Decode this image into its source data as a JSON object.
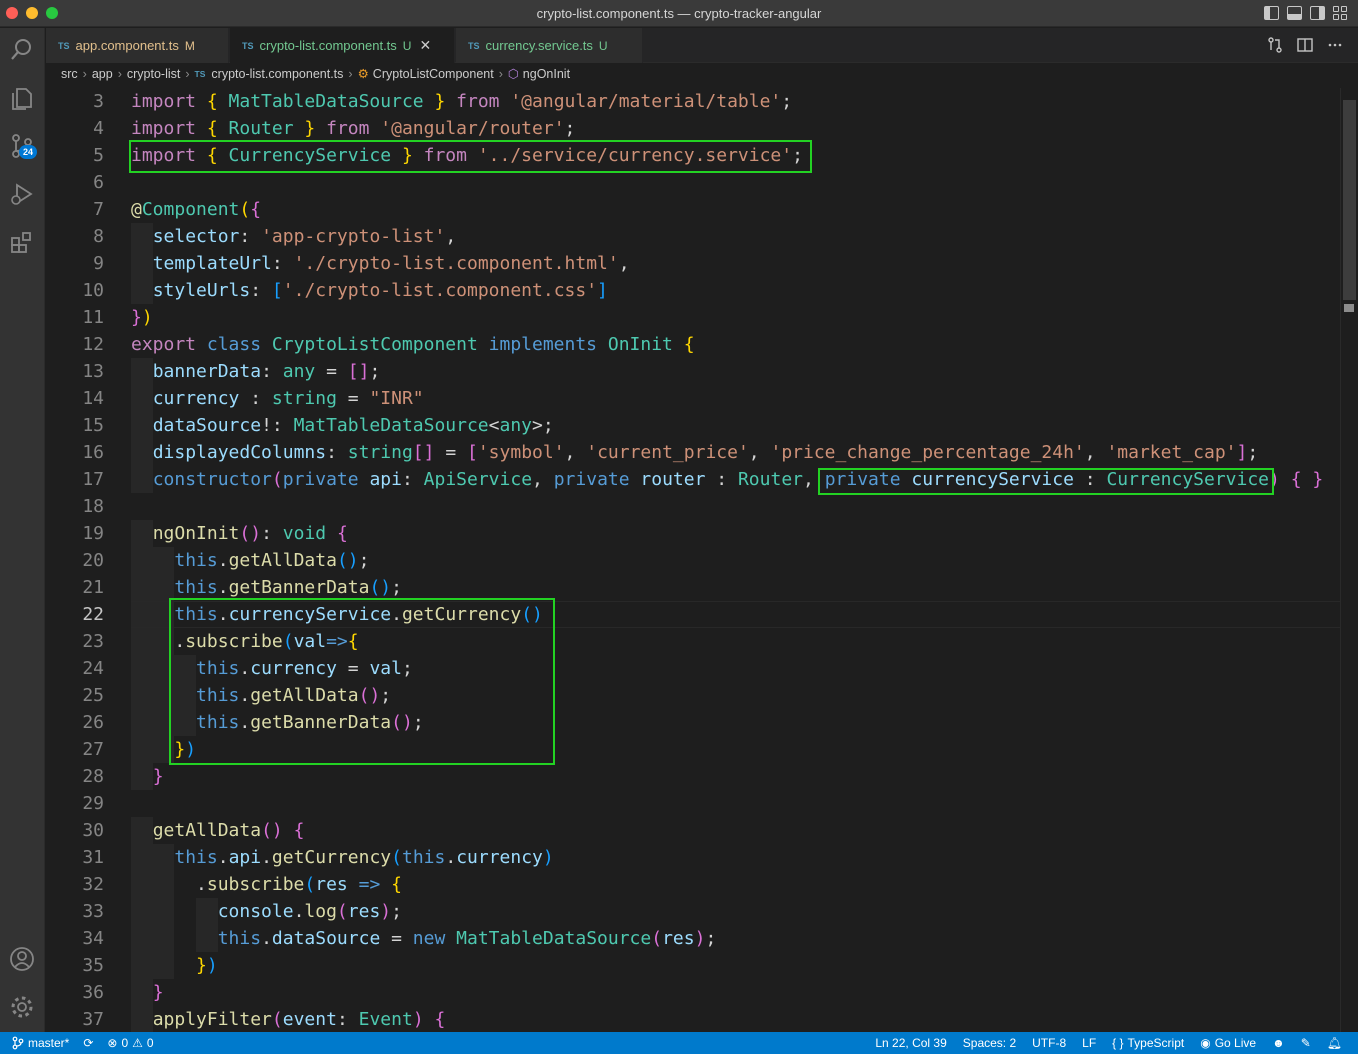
{
  "window": {
    "title": "crypto-list.component.ts — crypto-tracker-angular"
  },
  "activity": {
    "scm_badge": "24"
  },
  "tabs": [
    {
      "icon": "TS",
      "label": "app.component.ts",
      "status": "M",
      "kind": "m"
    },
    {
      "icon": "TS",
      "label": "crypto-list.component.ts",
      "status": "U",
      "kind": "u",
      "active": true
    },
    {
      "icon": "TS",
      "label": "currency.service.ts",
      "status": "U",
      "kind": "u"
    }
  ],
  "breadcrumb": {
    "seg1": "src",
    "seg2": "app",
    "seg3": "crypto-list",
    "file_icon": "TS",
    "file": "crypto-list.component.ts",
    "class_name": "CryptoListComponent",
    "method": "ngOnInit"
  },
  "colors": {
    "highlight_box": "#23d223",
    "statusbar": "#007acc",
    "keyword": "#c586c0",
    "string": "#ce9178",
    "type": "#4ec9b0",
    "function": "#dcdcaa",
    "variable": "#9cdcfe"
  },
  "editor": {
    "current_line": 22,
    "lines": [
      {
        "n": "3",
        "t": [
          [
            "kw",
            "import "
          ],
          [
            "b1",
            "{ "
          ],
          [
            "ty",
            "MatTableDataSource"
          ],
          [
            "b1",
            " }"
          ],
          [
            "kw",
            " from "
          ],
          [
            "str",
            "'@angular/material/table'"
          ],
          [
            "pl",
            ";"
          ]
        ]
      },
      {
        "n": "4",
        "t": [
          [
            "kw",
            "import "
          ],
          [
            "b1",
            "{ "
          ],
          [
            "ty",
            "Router"
          ],
          [
            "b1",
            " }"
          ],
          [
            "kw",
            " from "
          ],
          [
            "str",
            "'@angular/router'"
          ],
          [
            "pl",
            ";"
          ]
        ]
      },
      {
        "n": "5",
        "t": [
          [
            "kw",
            "import "
          ],
          [
            "b1",
            "{ "
          ],
          [
            "ty",
            "CurrencyService"
          ],
          [
            "b1",
            " }"
          ],
          [
            "kw",
            " from "
          ],
          [
            "str",
            "'../service/currency.service'"
          ],
          [
            "pl",
            ";"
          ]
        ]
      },
      {
        "n": "6",
        "t": []
      },
      {
        "n": "7",
        "t": [
          [
            "fn",
            "@"
          ],
          [
            "ty",
            "Component"
          ],
          [
            "b1",
            "("
          ],
          [
            "b2",
            "{"
          ]
        ]
      },
      {
        "n": "8",
        "t": [
          [
            "pl",
            "  "
          ],
          [
            "vr",
            "selector"
          ],
          [
            "pl",
            ": "
          ],
          [
            "str",
            "'app-crypto-list'"
          ],
          [
            "pl",
            ","
          ]
        ]
      },
      {
        "n": "9",
        "t": [
          [
            "pl",
            "  "
          ],
          [
            "vr",
            "templateUrl"
          ],
          [
            "pl",
            ": "
          ],
          [
            "str",
            "'./crypto-list.component.html'"
          ],
          [
            "pl",
            ","
          ]
        ]
      },
      {
        "n": "10",
        "t": [
          [
            "pl",
            "  "
          ],
          [
            "vr",
            "styleUrls"
          ],
          [
            "pl",
            ": "
          ],
          [
            "b3",
            "["
          ],
          [
            "str",
            "'./crypto-list.component.css'"
          ],
          [
            "b3",
            "]"
          ]
        ]
      },
      {
        "n": "11",
        "t": [
          [
            "b2",
            "}"
          ],
          [
            "b1",
            ")"
          ]
        ]
      },
      {
        "n": "12",
        "t": [
          [
            "kw",
            "export "
          ],
          [
            "bl",
            "class "
          ],
          [
            "ty",
            "CryptoListComponent "
          ],
          [
            "bl",
            "implements "
          ],
          [
            "ty",
            "OnInit "
          ],
          [
            "b1",
            "{"
          ]
        ]
      },
      {
        "n": "13",
        "t": [
          [
            "pl",
            "  "
          ],
          [
            "vr",
            "bannerData"
          ],
          [
            "pl",
            ": "
          ],
          [
            "ty",
            "any"
          ],
          [
            "pl",
            " = "
          ],
          [
            "b2",
            "[]"
          ],
          [
            "pl",
            ";"
          ]
        ]
      },
      {
        "n": "14",
        "t": [
          [
            "pl",
            "  "
          ],
          [
            "vr",
            "currency"
          ],
          [
            "pl",
            " : "
          ],
          [
            "ty",
            "string"
          ],
          [
            "pl",
            " = "
          ],
          [
            "str",
            "\"INR\""
          ]
        ]
      },
      {
        "n": "15",
        "t": [
          [
            "pl",
            "  "
          ],
          [
            "vr",
            "dataSource"
          ],
          [
            "pl",
            "!: "
          ],
          [
            "ty",
            "MatTableDataSource"
          ],
          [
            "pl",
            "<"
          ],
          [
            "ty",
            "any"
          ],
          [
            "pl",
            ">;"
          ]
        ]
      },
      {
        "n": "16",
        "t": [
          [
            "pl",
            "  "
          ],
          [
            "vr",
            "displayedColumns"
          ],
          [
            "pl",
            ": "
          ],
          [
            "ty",
            "string"
          ],
          [
            "b2",
            "[]"
          ],
          [
            "pl",
            " = "
          ],
          [
            "b2",
            "["
          ],
          [
            "str",
            "'symbol'"
          ],
          [
            "pl",
            ", "
          ],
          [
            "str",
            "'current_price'"
          ],
          [
            "pl",
            ", "
          ],
          [
            "str",
            "'price_change_percentage_24h'"
          ],
          [
            "pl",
            ", "
          ],
          [
            "str",
            "'market_cap'"
          ],
          [
            "b2",
            "]"
          ],
          [
            "pl",
            ";"
          ]
        ]
      },
      {
        "n": "17",
        "t": [
          [
            "pl",
            "  "
          ],
          [
            "bl",
            "constructor"
          ],
          [
            "b2",
            "("
          ],
          [
            "bl",
            "private "
          ],
          [
            "vr",
            "api"
          ],
          [
            "pl",
            ": "
          ],
          [
            "ty",
            "ApiService"
          ],
          [
            "pl",
            ", "
          ],
          [
            "bl",
            "private "
          ],
          [
            "vr",
            "router"
          ],
          [
            "pl",
            " : "
          ],
          [
            "ty",
            "Router"
          ],
          [
            "pl",
            ", "
          ],
          [
            "bl",
            "private "
          ],
          [
            "vr",
            "currencyService"
          ],
          [
            "pl",
            " : "
          ],
          [
            "ty",
            "CurrencyService"
          ],
          [
            "b2",
            ")"
          ],
          [
            "pl",
            " "
          ],
          [
            "b2",
            "{ }"
          ]
        ]
      },
      {
        "n": "18",
        "t": []
      },
      {
        "n": "19",
        "t": [
          [
            "pl",
            "  "
          ],
          [
            "fn",
            "ngOnInit"
          ],
          [
            "b2",
            "()"
          ],
          [
            "pl",
            ": "
          ],
          [
            "ty",
            "void"
          ],
          [
            "pl",
            " "
          ],
          [
            "b2",
            "{"
          ]
        ]
      },
      {
        "n": "20",
        "t": [
          [
            "pl",
            "    "
          ],
          [
            "bl",
            "this"
          ],
          [
            "pl",
            "."
          ],
          [
            "fn",
            "getAllData"
          ],
          [
            "b3",
            "()"
          ],
          [
            "pl",
            ";"
          ]
        ]
      },
      {
        "n": "21",
        "t": [
          [
            "pl",
            "    "
          ],
          [
            "bl",
            "this"
          ],
          [
            "pl",
            "."
          ],
          [
            "fn",
            "getBannerData"
          ],
          [
            "b3",
            "()"
          ],
          [
            "pl",
            ";"
          ]
        ]
      },
      {
        "n": "22",
        "t": [
          [
            "pl",
            "    "
          ],
          [
            "bl",
            "this"
          ],
          [
            "pl",
            "."
          ],
          [
            "vr",
            "currencyService"
          ],
          [
            "pl",
            "."
          ],
          [
            "fn",
            "getCurrency"
          ],
          [
            "b3",
            "()"
          ]
        ]
      },
      {
        "n": "23",
        "t": [
          [
            "pl",
            "    ."
          ],
          [
            "fn",
            "subscribe"
          ],
          [
            "b3",
            "("
          ],
          [
            "vr",
            "val"
          ],
          [
            "bl",
            "=>"
          ],
          [
            "b1",
            "{"
          ]
        ]
      },
      {
        "n": "24",
        "t": [
          [
            "pl",
            "      "
          ],
          [
            "bl",
            "this"
          ],
          [
            "pl",
            "."
          ],
          [
            "vr",
            "currency"
          ],
          [
            "pl",
            " = "
          ],
          [
            "vr",
            "val"
          ],
          [
            "pl",
            ";"
          ]
        ]
      },
      {
        "n": "25",
        "t": [
          [
            "pl",
            "      "
          ],
          [
            "bl",
            "this"
          ],
          [
            "pl",
            "."
          ],
          [
            "fn",
            "getAllData"
          ],
          [
            "b2",
            "()"
          ],
          [
            "pl",
            ";"
          ]
        ]
      },
      {
        "n": "26",
        "t": [
          [
            "pl",
            "      "
          ],
          [
            "bl",
            "this"
          ],
          [
            "pl",
            "."
          ],
          [
            "fn",
            "getBannerData"
          ],
          [
            "b2",
            "()"
          ],
          [
            "pl",
            ";"
          ]
        ]
      },
      {
        "n": "27",
        "t": [
          [
            "pl",
            "    "
          ],
          [
            "b1",
            "}"
          ],
          [
            "b3",
            ")"
          ]
        ]
      },
      {
        "n": "28",
        "t": [
          [
            "pl",
            "  "
          ],
          [
            "b2",
            "}"
          ]
        ]
      },
      {
        "n": "29",
        "t": []
      },
      {
        "n": "30",
        "t": [
          [
            "pl",
            "  "
          ],
          [
            "fn",
            "getAllData"
          ],
          [
            "b2",
            "()"
          ],
          [
            "pl",
            " "
          ],
          [
            "b2",
            "{"
          ]
        ]
      },
      {
        "n": "31",
        "t": [
          [
            "pl",
            "    "
          ],
          [
            "bl",
            "this"
          ],
          [
            "pl",
            "."
          ],
          [
            "vr",
            "api"
          ],
          [
            "pl",
            "."
          ],
          [
            "fn",
            "getCurrency"
          ],
          [
            "b3",
            "("
          ],
          [
            "bl",
            "this"
          ],
          [
            "pl",
            "."
          ],
          [
            "vr",
            "currency"
          ],
          [
            "b3",
            ")"
          ]
        ]
      },
      {
        "n": "32",
        "t": [
          [
            "pl",
            "      ."
          ],
          [
            "fn",
            "subscribe"
          ],
          [
            "b3",
            "("
          ],
          [
            "vr",
            "res"
          ],
          [
            "pl",
            " "
          ],
          [
            "bl",
            "=>"
          ],
          [
            "pl",
            " "
          ],
          [
            "b1",
            "{"
          ]
        ]
      },
      {
        "n": "33",
        "t": [
          [
            "pl",
            "        "
          ],
          [
            "vr",
            "console"
          ],
          [
            "pl",
            "."
          ],
          [
            "fn",
            "log"
          ],
          [
            "b2",
            "("
          ],
          [
            "vr",
            "res"
          ],
          [
            "b2",
            ")"
          ],
          [
            "pl",
            ";"
          ]
        ]
      },
      {
        "n": "34",
        "t": [
          [
            "pl",
            "        "
          ],
          [
            "bl",
            "this"
          ],
          [
            "pl",
            "."
          ],
          [
            "vr",
            "dataSource"
          ],
          [
            "pl",
            " = "
          ],
          [
            "bl",
            "new "
          ],
          [
            "ty",
            "MatTableDataSource"
          ],
          [
            "b2",
            "("
          ],
          [
            "vr",
            "res"
          ],
          [
            "b2",
            ")"
          ],
          [
            "pl",
            ";"
          ]
        ]
      },
      {
        "n": "35",
        "t": [
          [
            "pl",
            "      "
          ],
          [
            "b1",
            "}"
          ],
          [
            "b3",
            ")"
          ]
        ]
      },
      {
        "n": "36",
        "t": [
          [
            "pl",
            "  "
          ],
          [
            "b2",
            "}"
          ]
        ]
      },
      {
        "n": "37",
        "t": [
          [
            "pl",
            "  "
          ],
          [
            "fn",
            "applyFilter"
          ],
          [
            "b2",
            "("
          ],
          [
            "vr",
            "event"
          ],
          [
            "pl",
            ": "
          ],
          [
            "ty",
            "Event"
          ],
          [
            "b2",
            ")"
          ],
          [
            "pl",
            " "
          ],
          [
            "b2",
            "{"
          ]
        ]
      }
    ]
  },
  "statusbar": {
    "branch": "master*",
    "errors": "0",
    "warnings": "0",
    "position": "Ln 22, Col 39",
    "spaces": "Spaces: 2",
    "encoding": "UTF-8",
    "eol": "LF",
    "language": "TypeScript",
    "golive": "Go Live"
  }
}
